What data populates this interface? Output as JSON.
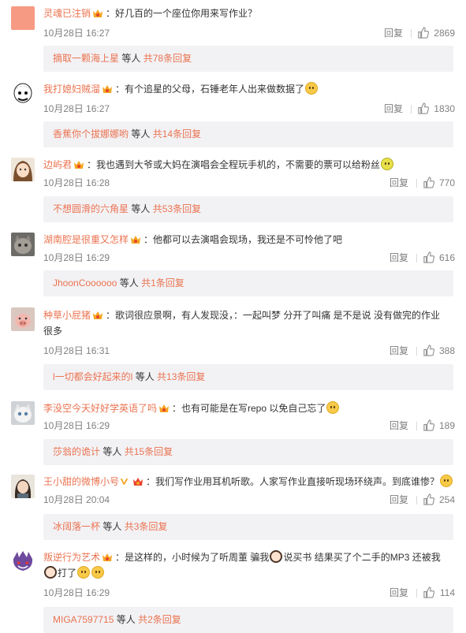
{
  "reply_label": "回复",
  "others_label": "等人",
  "comments": [
    {
      "username": "灵魂已注销",
      "text": "：好几百的一个座位你用来写作业？",
      "time": "10月28日 16:27",
      "likes": "2869",
      "sub_who": "摘取一颗海上星",
      "sub_count": "共78条回复"
    },
    {
      "username": "我打媳妇贼溜",
      "text": "：有个追星的父母，石锤老年人出来做数据了",
      "time": "10月28日 16:27",
      "likes": "1830",
      "sub_who": "香蕉你个拔娜娜哟",
      "sub_count": "共14条回复"
    },
    {
      "username": "边屿君",
      "text": "：我也遇到大爷或大妈在演唱会全程玩手机的，不需要的票可以给粉丝",
      "time": "10月28日 16:28",
      "likes": "770",
      "sub_who": "不想圆滑的六角星",
      "sub_count": "共53条回复"
    },
    {
      "username": "湖南腔是很重又怎样",
      "text": "：他都可以去演唱会现场，我还是不可怜他了吧",
      "time": "10月28日 16:29",
      "likes": "616",
      "sub_who": "JhoonCoooooo",
      "sub_count": "共1条回复"
    },
    {
      "username": "种草小屁猪",
      "text": "：歌词很应景啊，有人发现没，：一起叫梦 分开了叫痛  是不是说 没有做完的作业",
      "text2": "很多",
      "time": "10月28日 16:31",
      "likes": "388",
      "sub_who": "l一切都会好起来的l",
      "sub_count": "共13条回复"
    },
    {
      "username": "李没空今天好好学英语了吗",
      "text": "：也有可能是在写repo 以免自己忘了",
      "time": "10月28日 16:29",
      "likes": "189",
      "sub_who": "莎翁的诡计",
      "sub_count": "共15条回复"
    },
    {
      "username": "王小甜的微博小号",
      "text": "：我们写作业用耳机听歌。人家写作业直接听现场环绕声。到底谁惨？",
      "time": "10月28日 20:04",
      "likes": "254",
      "sub_who": "冰阔落一杯",
      "sub_count": "共3条回复"
    },
    {
      "username": "叛逆行为艺术",
      "text": "：是这样的，小时候为了听周董 骗我",
      "text_b": "说买书 结果买了个二手的MP3  还被我",
      "text2": "打了",
      "time": "10月28日 16:29",
      "likes": "114",
      "sub_who": "MIGA7597715",
      "sub_count": "共2条回复"
    }
  ],
  "colors": {
    "username": "#eb7350",
    "meta": "#808080",
    "sub_bg": "#f2f2f5"
  }
}
